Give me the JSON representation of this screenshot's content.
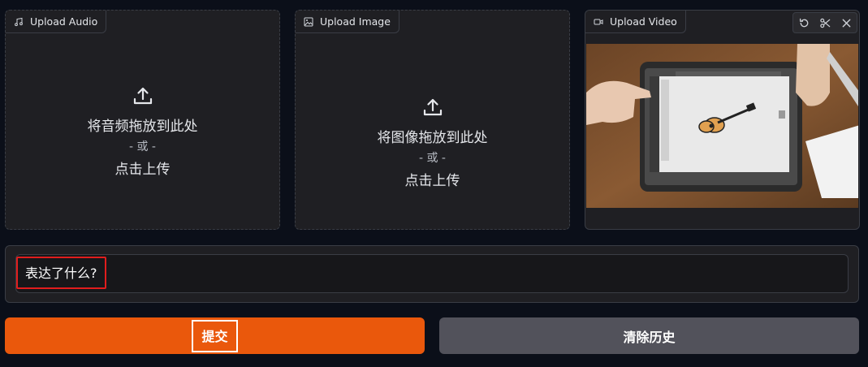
{
  "audio_panel": {
    "tab_label": "Upload Audio",
    "drop_line1": "将音频拖放到此处",
    "drop_or": "- 或 -",
    "drop_line2": "点击上传"
  },
  "image_panel": {
    "tab_label": "Upload Image",
    "drop_line1": "将图像拖放到此处",
    "drop_or": "- 或 -",
    "drop_line2": "点击上传"
  },
  "video_panel": {
    "tab_label": "Upload Video",
    "tools": [
      "undo-icon",
      "scissors-icon",
      "close-icon"
    ]
  },
  "textbox": {
    "value": "表达了什么?"
  },
  "buttons": {
    "submit_label": "提交",
    "clear_label": "清除历史"
  },
  "colors": {
    "accent": "#ea580c",
    "secondary": "#52525b",
    "highlight": "#e11d1d"
  }
}
